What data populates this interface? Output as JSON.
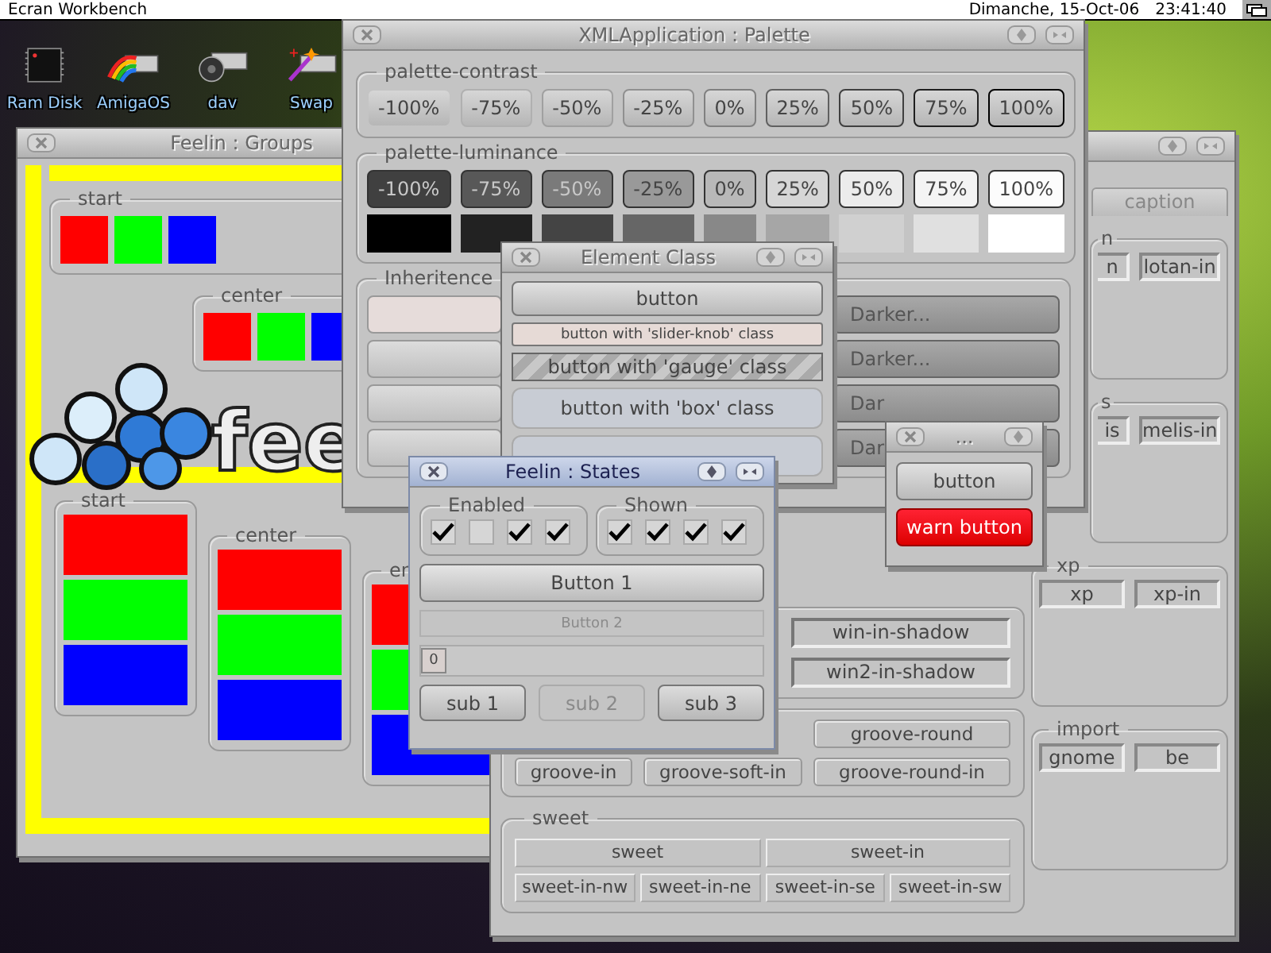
{
  "menubar": {
    "title": "Ecran Workbench",
    "date": "Dimanche, 15-Oct-06",
    "time": "23:41:40"
  },
  "desktop_icons": [
    {
      "label": "Ram Disk",
      "kind": "chip"
    },
    {
      "label": "AmigaOS",
      "kind": "rainbow"
    },
    {
      "label": "dav",
      "kind": "disc"
    },
    {
      "label": "Swap",
      "kind": "wand"
    }
  ],
  "groups_window": {
    "title": "Feelin : Groups",
    "active": false,
    "logo_text": "fee",
    "top_groups": [
      {
        "legend": "start",
        "blocks": [
          {
            "color": "#ff0000"
          },
          {
            "color": "#00ff00"
          },
          {
            "color": "#0000ff"
          }
        ]
      },
      {
        "legend": "center",
        "blocks": [
          {
            "color": "#ff0000"
          },
          {
            "color": "#00ff00"
          },
          {
            "color": "#0000ff"
          }
        ]
      }
    ],
    "bottom_groups": [
      {
        "legend": "start",
        "blocks": [
          {
            "color": "#ff0000"
          },
          {
            "color": "#00ff00"
          },
          {
            "color": "#0000ff"
          }
        ]
      },
      {
        "legend": "center",
        "blocks": [
          {
            "color": "#ff0000"
          },
          {
            "color": "#00ff00"
          },
          {
            "color": "#0000ff"
          }
        ]
      },
      {
        "legend": "en",
        "blocks": [
          {
            "color": "#ff0000"
          },
          {
            "color": "#00ff00"
          },
          {
            "color": "#0000ff"
          }
        ]
      }
    ]
  },
  "palette_window": {
    "title": "XMLApplication : Palette",
    "active": false,
    "contrast": {
      "legend": "palette-contrast",
      "buttons": [
        {
          "label": "-100%",
          "color": "#c4c4c4"
        },
        {
          "label": "-75%",
          "color": "#b0b0b0"
        },
        {
          "label": "-50%",
          "color": "#a0a0a0"
        },
        {
          "label": "-25%",
          "color": "#909090"
        },
        {
          "label": "0%",
          "color": "#808080"
        },
        {
          "label": "25%",
          "color": "#606060"
        },
        {
          "label": "50%",
          "color": "#404040"
        },
        {
          "label": "75%",
          "color": "#202020"
        },
        {
          "label": "100%",
          "color": "#000000"
        }
      ]
    },
    "luminance": {
      "legend": "palette-luminance",
      "buttons": [
        {
          "label": "-100%",
          "color": "#404040"
        },
        {
          "label": "-75%",
          "color": "#585858"
        },
        {
          "label": "-50%",
          "color": "#7a7a7a"
        },
        {
          "label": "-25%",
          "color": "#999999"
        },
        {
          "label": "0%",
          "color": "#b8b8b8"
        },
        {
          "label": "25%",
          "color": "#d6d6d6"
        },
        {
          "label": "50%",
          "color": "#ececec"
        },
        {
          "label": "75%",
          "color": "#f4f4f4"
        },
        {
          "label": "100%",
          "color": "#fcfcfc"
        }
      ],
      "swatches": [
        {
          "color": "#000000"
        },
        {
          "color": "#222222"
        },
        {
          "color": "#444444"
        },
        {
          "color": "#666666"
        },
        {
          "color": "#888888"
        },
        {
          "color": "#a6a6a6"
        },
        {
          "color": "#d0d0d0"
        },
        {
          "color": "#e0e0e0"
        },
        {
          "color": "#ffffff"
        }
      ]
    },
    "inheritence": {
      "legend": "Inheritence",
      "rows": [
        {
          "label": "Darker..."
        },
        {
          "label": "Darker..."
        },
        {
          "label": "Dar"
        },
        {
          "label": "Dar"
        }
      ]
    }
  },
  "element_window": {
    "title": "Element Class",
    "active": false,
    "buttons": [
      {
        "label": "button",
        "kind": "plain"
      },
      {
        "label": "button with 'slider-knob' class",
        "kind": "knob"
      },
      {
        "label": "button with 'gauge' class",
        "kind": "gauge"
      },
      {
        "label": "button with 'box' class",
        "kind": "box"
      }
    ]
  },
  "small_window": {
    "title": "...",
    "active": false,
    "buttons": [
      {
        "label": "button",
        "kind": "plain"
      },
      {
        "label": "warn button",
        "kind": "warn"
      }
    ]
  },
  "states_window": {
    "title": "Feelin : States",
    "active": true,
    "groups": [
      {
        "legend": "Enabled",
        "boxes": [
          {
            "checked": true
          },
          {
            "checked": false
          },
          {
            "checked": true
          },
          {
            "checked": true
          }
        ]
      },
      {
        "legend": "Shown",
        "boxes": [
          {
            "checked": true
          },
          {
            "checked": true
          },
          {
            "checked": true
          },
          {
            "checked": true
          }
        ]
      }
    ],
    "buttons": [
      {
        "label": "Button 1",
        "disabled": false
      },
      {
        "label": "Button 2",
        "disabled": true
      }
    ],
    "slider": {
      "knob": "0",
      "level": 0
    },
    "sub_buttons": [
      {
        "label": "sub 1",
        "disabled": false
      },
      {
        "label": "sub 2",
        "disabled": true
      },
      {
        "label": "sub 3",
        "disabled": false
      }
    ]
  },
  "frames_window": {
    "tab": "caption",
    "side_groups": [
      {
        "legend": "n",
        "items": [
          "n",
          "lotan-in"
        ]
      },
      {
        "legend": "s",
        "items": [
          "is",
          "melis-in"
        ]
      },
      {
        "legend": "xp",
        "items": [
          "xp",
          "xp-in"
        ]
      },
      {
        "legend": "import",
        "items": [
          "gnome",
          "be"
        ]
      }
    ],
    "shadow_items": [
      "win-in-shadow",
      "win2-in-shadow"
    ],
    "groove_items": [
      "groove-round",
      "groove-in",
      "groove-soft-in",
      "groove-round-in"
    ],
    "sweet": {
      "legend": "sweet",
      "items": [
        "sweet",
        "sweet-in",
        "sweet-in-nw",
        "sweet-in-ne",
        "sweet-in-se",
        "sweet-in-sw"
      ]
    }
  }
}
